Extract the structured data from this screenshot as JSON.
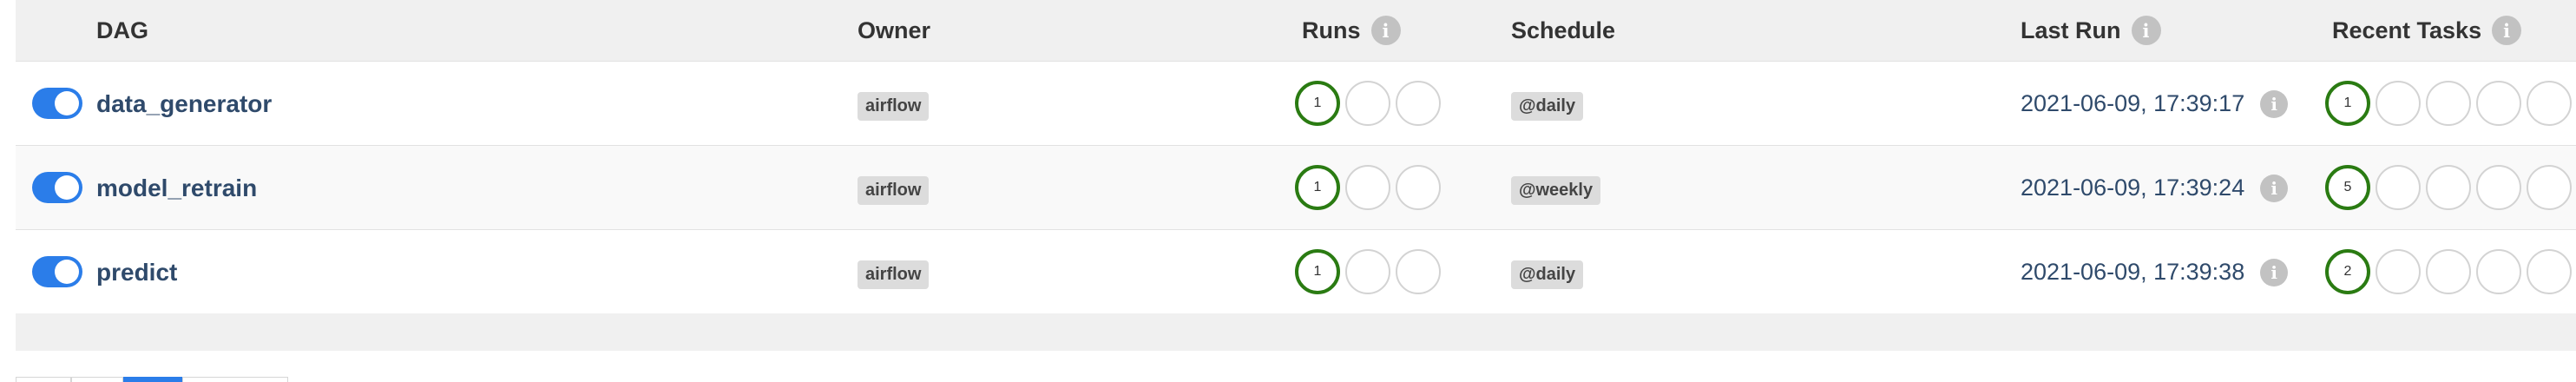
{
  "header": {
    "dag": "DAG",
    "owner": "Owner",
    "runs": "Runs",
    "schedule": "Schedule",
    "last_run": "Last Run",
    "recent_tasks": "Recent Tasks"
  },
  "icons": {
    "info": "i",
    "info_icon_name": "info-icon",
    "toggle_on_color": "#2b7de9",
    "success_color": "#2a7b12",
    "link_color": "#2f4a6b"
  },
  "dags": [
    {
      "name": "data_generator",
      "owner": "airflow",
      "runs": [
        "1",
        "",
        ""
      ],
      "schedule": "@daily",
      "last_run": "2021-06-09, 17:39:17",
      "recent_tasks": [
        "1",
        "",
        "",
        "",
        ""
      ],
      "paused": false
    },
    {
      "name": "model_retrain",
      "owner": "airflow",
      "runs": [
        "1",
        "",
        ""
      ],
      "schedule": "@weekly",
      "last_run": "2021-06-09, 17:39:24",
      "recent_tasks": [
        "5",
        "",
        "",
        "",
        ""
      ],
      "paused": false
    },
    {
      "name": "predict",
      "owner": "airflow",
      "runs": [
        "1",
        "",
        ""
      ],
      "schedule": "@daily",
      "last_run": "2021-06-09, 17:39:38",
      "recent_tasks": [
        "2",
        "",
        "",
        "",
        ""
      ],
      "paused": false
    }
  ]
}
